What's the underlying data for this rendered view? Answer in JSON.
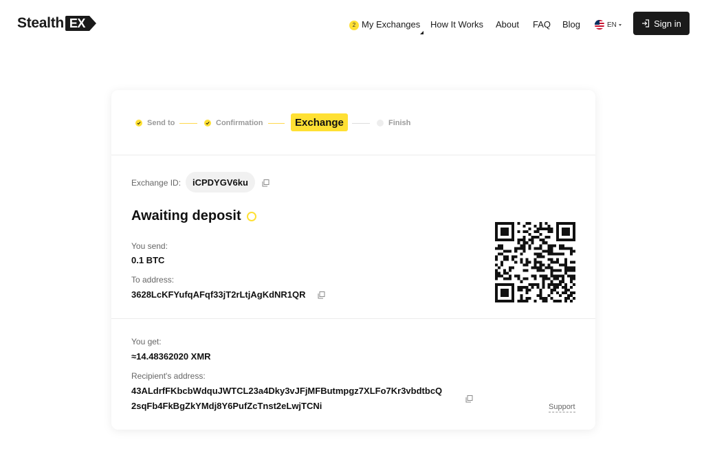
{
  "header": {
    "logo_text": "Stealth",
    "logo_badge": "EX",
    "nav": {
      "my_exchanges_count": "2",
      "my_exchanges": "My Exchanges",
      "how_it_works": "How It Works",
      "about": "About",
      "faq": "FAQ",
      "blog": "Blog",
      "language": "EN"
    },
    "signin_label": "Sign in"
  },
  "steps": {
    "send_to": "Send to",
    "confirmation": "Confirmation",
    "exchange": "Exchange",
    "finish": "Finish"
  },
  "exchange": {
    "id_label": "Exchange ID:",
    "id_value": "iCPDYGV6ku",
    "status": "Awaiting deposit",
    "send_label": "You send:",
    "send_value": "0.1 BTC",
    "to_address_label": "To address:",
    "to_address_value": "3628LcKFYufqAFqf33jT2rLtjAgKdNR1QR",
    "get_label": "You get:",
    "get_value": "≈14.48362020 XMR",
    "recipient_label": "Recipient's address:",
    "recipient_line1": "43ALdrfFKbcbWdquJWTCL23a4Dky3vJFjMFButmpgz7XLFo7Kr3vbdtbcQ",
    "recipient_line2": "2sqFb4FkBgZkYMdj8Y6PufZcTnst2eLwjTCNi",
    "support_label": "Support"
  },
  "colors": {
    "accent": "#ffe033",
    "dark": "#1a1a1a"
  }
}
